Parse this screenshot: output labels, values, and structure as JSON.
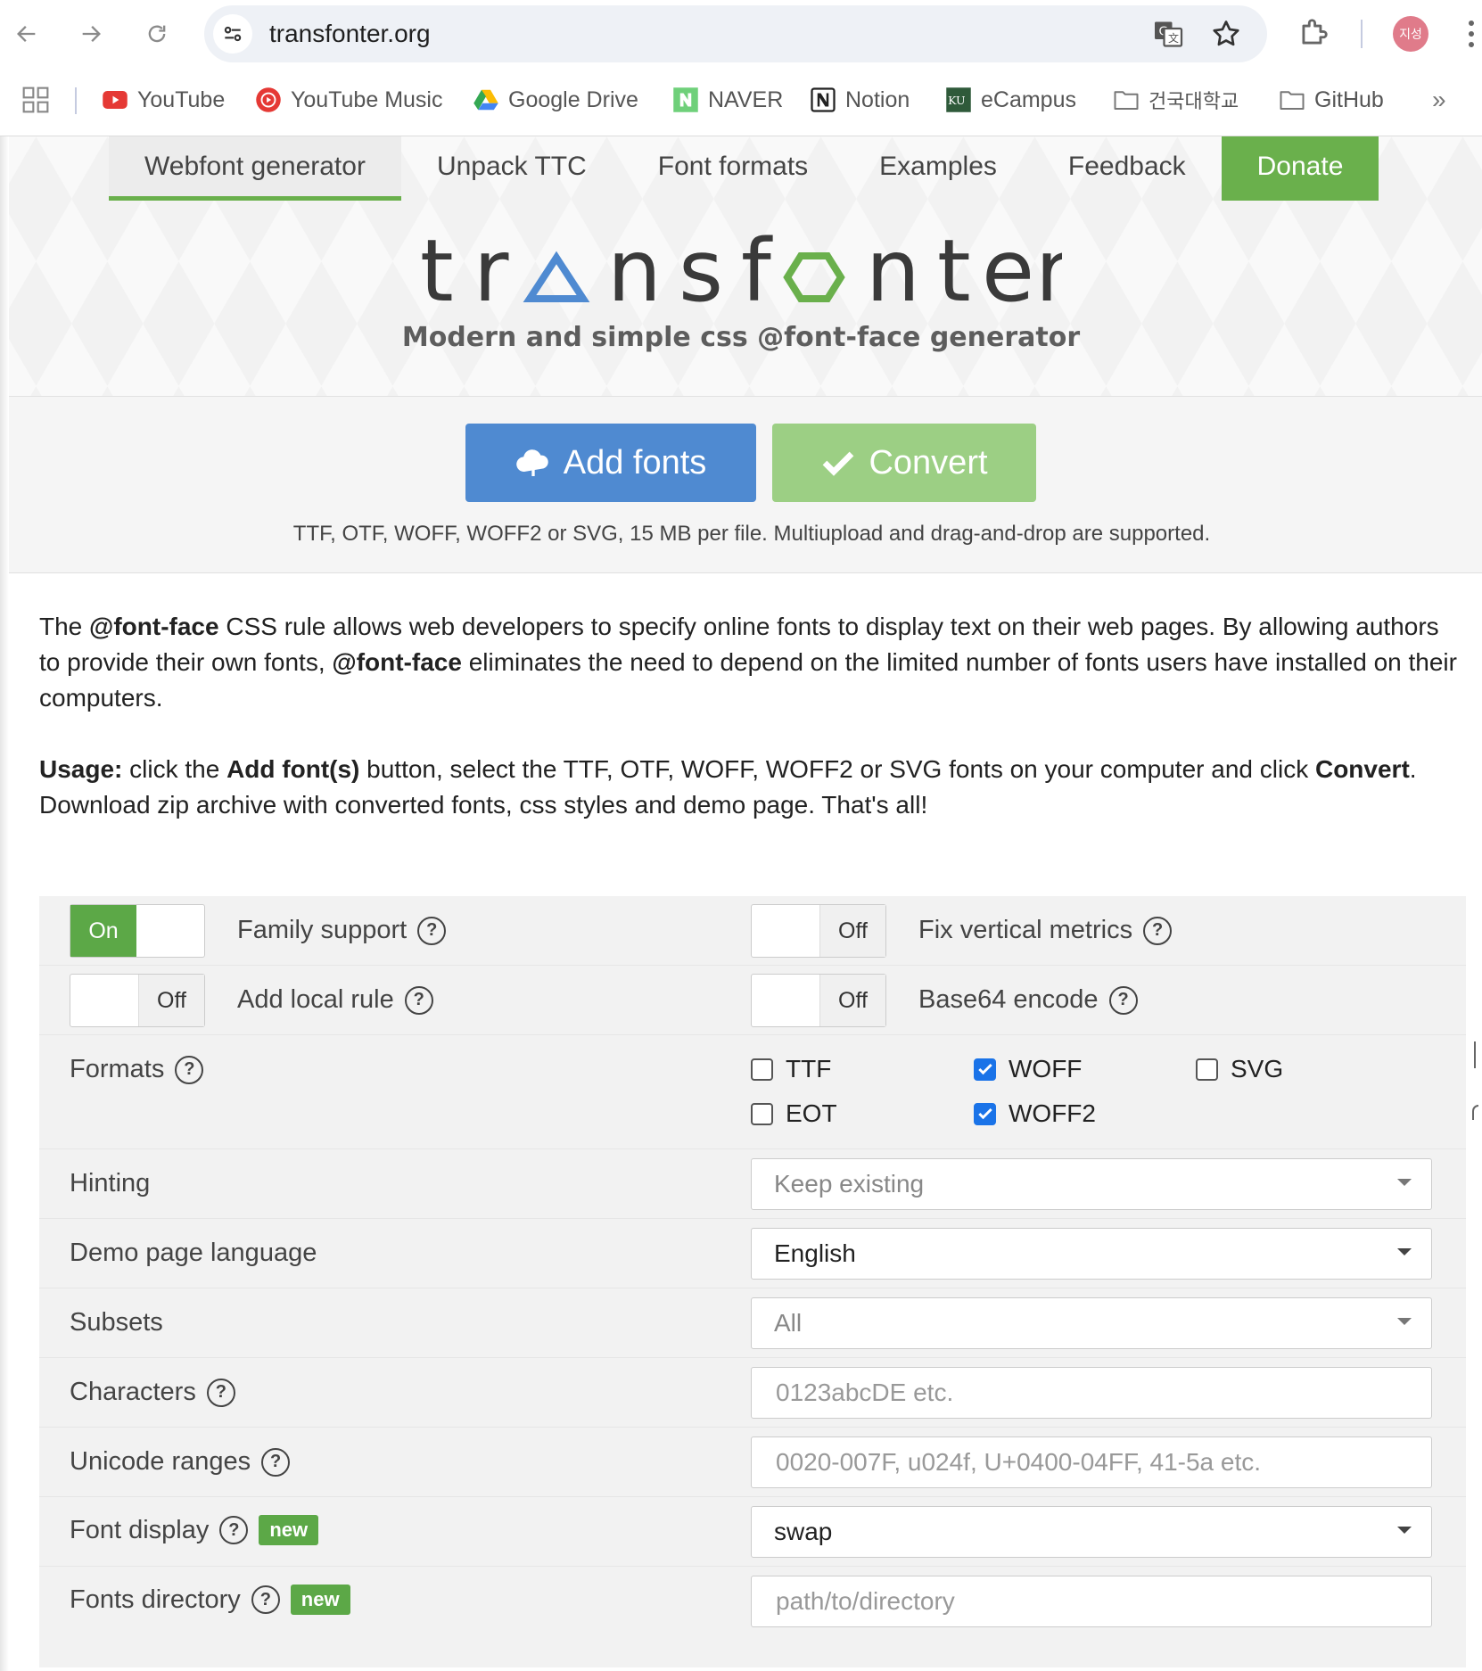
{
  "browser": {
    "url": "transfonter.org",
    "avatar_text": "지성",
    "bookmarks": [
      {
        "label": "YouTube",
        "icon": "youtube-icon"
      },
      {
        "label": "YouTube Music",
        "icon": "youtube-music-icon"
      },
      {
        "label": "Google Drive",
        "icon": "google-drive-icon"
      },
      {
        "label": "NAVER",
        "icon": "naver-icon"
      },
      {
        "label": "Notion",
        "icon": "notion-icon"
      },
      {
        "label": "eCampus",
        "icon": "ku-icon"
      },
      {
        "label": "건국대학교",
        "icon": "folder-icon"
      },
      {
        "label": "GitHub",
        "icon": "folder-icon"
      }
    ],
    "more": "»"
  },
  "nav": {
    "tabs": [
      {
        "label": "Webfont generator",
        "active": true
      },
      {
        "label": "Unpack TTC"
      },
      {
        "label": "Font formats"
      },
      {
        "label": "Examples"
      },
      {
        "label": "Feedback"
      },
      {
        "label": "Donate",
        "accent": "#6ab04c"
      }
    ]
  },
  "hero": {
    "logo_text": "transfonter",
    "tagline": "Modern and simple css @font-face generator"
  },
  "upload": {
    "add_label": "Add fonts",
    "convert_label": "Convert",
    "note": "TTF, OTF, WOFF, WOFF2 or SVG, 15 MB per file. Multiupload and drag-and-drop are supported."
  },
  "description": {
    "p1": {
      "a": "The ",
      "b1": "@font-face",
      "c": " CSS rule allows web developers to specify online fonts to display text on their web pages. By allowing authors to provide their own fonts, ",
      "b2": "@font-face",
      "d": " eliminates the need to depend on the limited number of fonts users have installed on their computers."
    },
    "p2": {
      "b1": "Usage:",
      "a": " click the ",
      "b2": "Add font(s)",
      "c": " button, select the TTF, OTF, WOFF, WOFF2 or SVG fonts on your computer and click ",
      "b3": "Convert",
      "d": ". Download zip archive with converted fonts, css styles and demo page. That's all!"
    }
  },
  "settings": {
    "family_support": {
      "label": "Family support",
      "state": "On"
    },
    "add_local_rule": {
      "label": "Add local rule",
      "state": "Off"
    },
    "fix_vertical_metrics": {
      "label": "Fix vertical metrics",
      "state": "Off"
    },
    "base64_encode": {
      "label": "Base64 encode",
      "state": "Off"
    },
    "formats": {
      "label": "Formats",
      "options": [
        {
          "label": "TTF",
          "checked": false
        },
        {
          "label": "WOFF",
          "checked": true
        },
        {
          "label": "SVG",
          "checked": false
        },
        {
          "label": "EOT",
          "checked": false
        },
        {
          "label": "WOFF2",
          "checked": true
        }
      ]
    },
    "hinting": {
      "label": "Hinting",
      "value": "Keep existing"
    },
    "demo_language": {
      "label": "Demo page language",
      "value": "English"
    },
    "subsets": {
      "label": "Subsets",
      "value": "All"
    },
    "characters": {
      "label": "Characters",
      "placeholder": "0123abcDE etc."
    },
    "unicode_ranges": {
      "label": "Unicode ranges",
      "placeholder": "0020-007F, u024f, U+0400-04FF, 41-5a etc."
    },
    "font_display": {
      "label": "Font display",
      "badge": "new",
      "value": "swap"
    },
    "fonts_directory": {
      "label": "Fonts directory",
      "badge": "new",
      "placeholder": "path/to/directory"
    },
    "help_glyph": "?"
  }
}
